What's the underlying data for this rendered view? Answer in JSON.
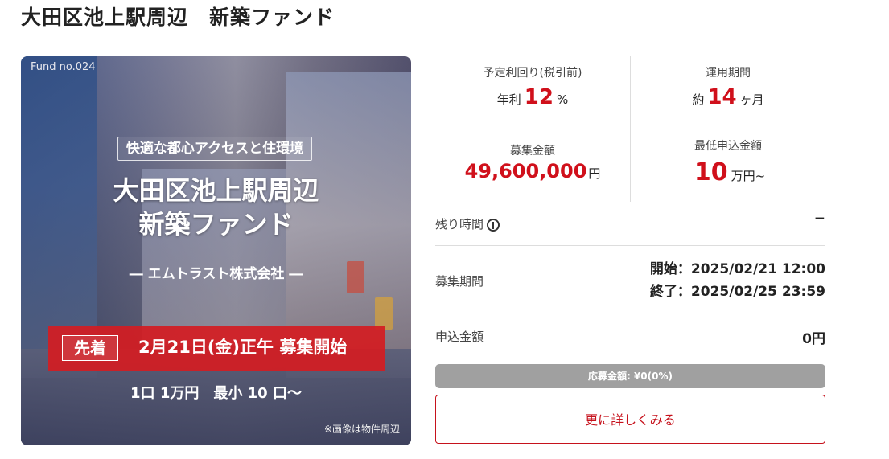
{
  "page": {
    "title": "大田区池上駅周辺　新築ファンド"
  },
  "hero": {
    "fund_no": "Fund no.024",
    "catch": "快適な都心アクセスと住環境",
    "name_line1": "大田区池上駅周辺",
    "name_line2": "新築ファンド",
    "company": "― エムトラスト株式会社 ―",
    "tag": "先着",
    "banner_text": "2月21日(金)正午 募集開始",
    "unit_text": "1口 1万円　最小 10 口〜",
    "note": "※画像は物件周辺"
  },
  "stats": {
    "yield_label": "予定利回り(税引前)",
    "yield_prefix": "年利",
    "yield_value": "12",
    "yield_suffix": "%",
    "period_label": "運用期間",
    "period_prefix": "約",
    "period_value": "14",
    "period_suffix": "ヶ月",
    "amount_label": "募集金額",
    "amount_value": "49,600,000",
    "amount_suffix": "円",
    "min_label": "最低申込金額",
    "min_value": "10",
    "min_suffix": "万円~"
  },
  "rows": {
    "remaining_label": "残り時間",
    "remaining_value": "−",
    "period_label": "募集期間",
    "period_start": "開始：2025/02/21 12:00",
    "period_end": "終了：2025/02/25 23:59",
    "applied_label": "申込金額",
    "applied_value": "0円"
  },
  "progress": {
    "text": "応募金額: ¥0(0%)",
    "percent": 0
  },
  "button": {
    "detail_label": "更に詳しくみる"
  },
  "colors": {
    "accent_red": "#d0101b",
    "progress_track": "#a0a0a0"
  }
}
